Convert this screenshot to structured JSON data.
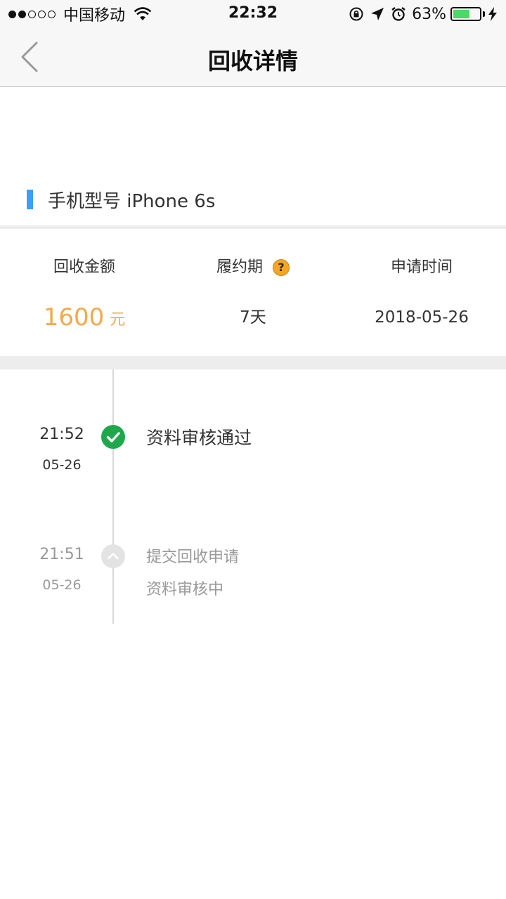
{
  "status_bar": {
    "carrier": "中国移动",
    "time": "22:32",
    "battery_percent": "63%",
    "battery_level": 0.63
  },
  "nav": {
    "title": "回收详情"
  },
  "model": {
    "text": "手机型号 iPhone 6s"
  },
  "info": {
    "amount_label": "回收金额",
    "amount_value": "1600",
    "amount_unit": "元",
    "period_label": "履约期",
    "period_value": "7天",
    "date_label": "申请时间",
    "date_value": "2018-05-26"
  },
  "timeline": [
    {
      "time": "21:52",
      "date": "05-26",
      "title": "资料审核通过",
      "status": "done"
    },
    {
      "time": "21:51",
      "date": "05-26",
      "title": "提交回收申请",
      "subtitle": "资料审核中",
      "status": "pending"
    }
  ],
  "colors": {
    "accent_blue": "#3a9ff5",
    "amount_orange": "#f5a84a",
    "success_green": "#1fa84b",
    "battery_green": "#4cd964"
  }
}
